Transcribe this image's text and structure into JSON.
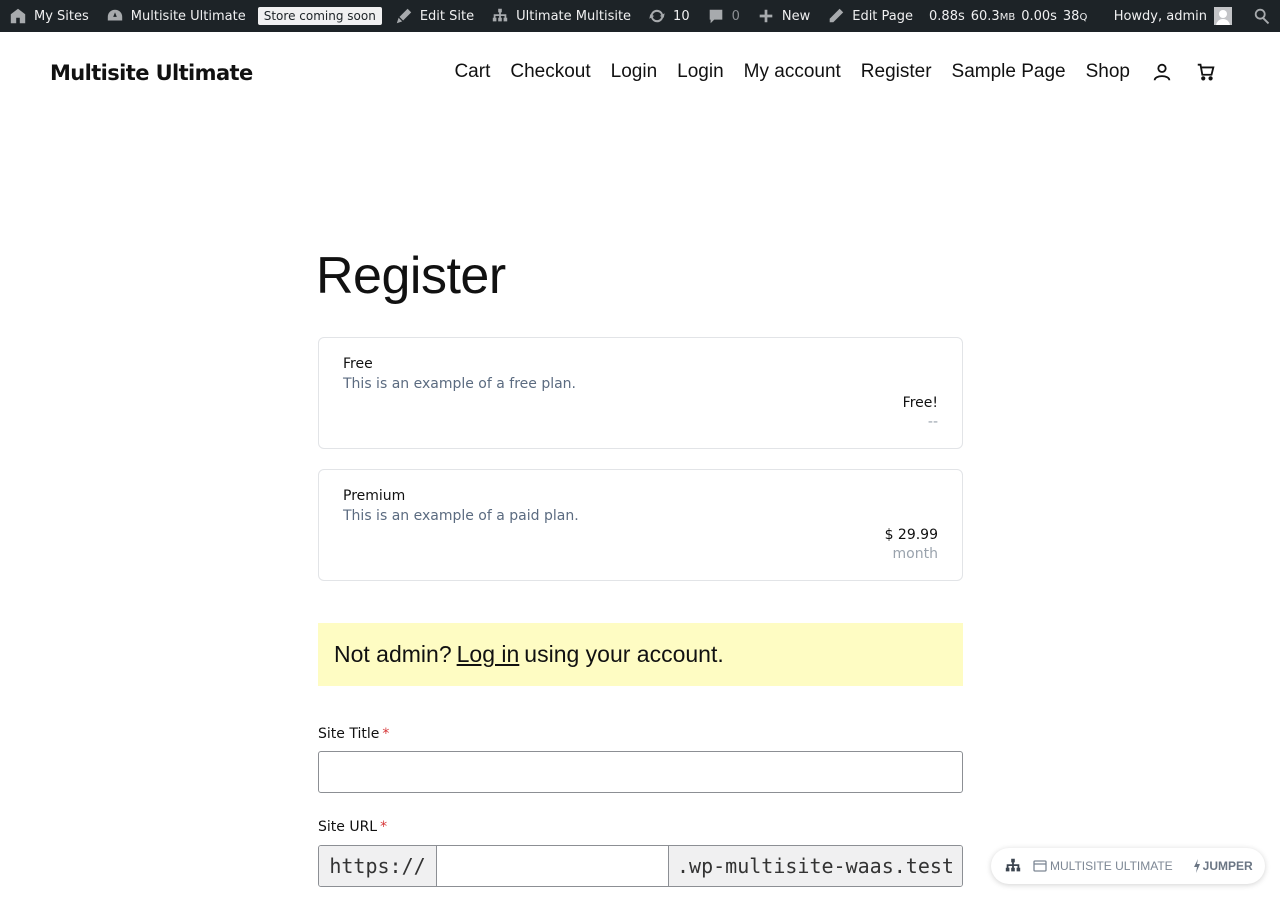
{
  "admin_bar": {
    "my_sites": "My Sites",
    "site_name": "Multisite Ultimate",
    "store_badge": "Store coming soon",
    "edit_site": "Edit Site",
    "network": "Ultimate Multisite",
    "updates_count": "10",
    "comments_count": "0",
    "new_label": "New",
    "edit_page": "Edit Page",
    "perf_time": "0.88s",
    "perf_mem": "60.3",
    "perf_mem_unit": "MB",
    "perf_query_time": "0.00s",
    "perf_queries": "38",
    "perf_queries_unit": "Q",
    "greeting": "Howdy, admin"
  },
  "header": {
    "site_title": "Multisite Ultimate",
    "nav": [
      "Cart",
      "Checkout",
      "Login",
      "Login",
      "My account",
      "Register",
      "Sample Page",
      "Shop"
    ]
  },
  "page": {
    "title": "Register"
  },
  "plans": [
    {
      "name": "Free",
      "description": "This is an example of a free plan.",
      "price": "Free!",
      "period": "--"
    },
    {
      "name": "Premium",
      "description": "This is an example of a paid plan.",
      "price": "$ 29.99",
      "period": "month"
    }
  ],
  "notice": {
    "prefix": "Not admin?",
    "link": "Log in",
    "suffix": "using your account."
  },
  "form": {
    "site_title_label": "Site Title",
    "site_url_label": "Site URL",
    "required_mark": "*",
    "url_prefix": "https://",
    "url_suffix": ".wp-multisite-waas.test"
  },
  "jumper": {
    "site_label": "MULTISITE ULTIMATE",
    "jumper_label": "JUMPER"
  },
  "colors": {
    "admin_bar_bg": "#1d2327",
    "notice_bg": "#fefcc3",
    "required": "#d63638"
  }
}
